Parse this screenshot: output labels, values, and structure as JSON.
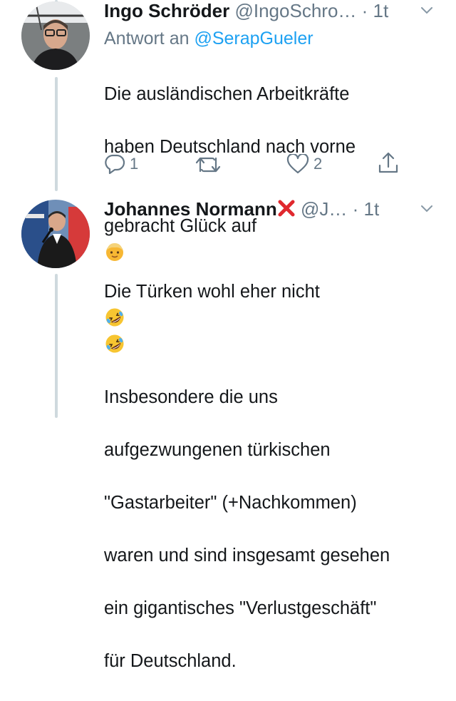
{
  "tweets": [
    {
      "author_name": "Ingo Schröder",
      "handle": "@IngoSchro…",
      "separator": "·",
      "time": "1t",
      "reply_to_prefix": "Antwort an",
      "reply_to_handle": "@SerapGueler",
      "text_lines": [
        "Die ausländischen Arbeitkräfte",
        "haben Deutschland nach vorne",
        "gebracht Glück auf"
      ],
      "actions": {
        "reply_count": "1",
        "retweet_count": "",
        "like_count": "2"
      }
    },
    {
      "author_name": "Johannes Normann",
      "handle": "@J…",
      "separator": "·",
      "time": "1t",
      "text_lines": [
        "Die Türken wohl eher nicht",
        "Insbesondere die uns",
        "aufgezwungenen türkischen",
        "\"Gastarbeiter\" (+Nachkommen)",
        "waren und sind insgesamt gesehen",
        "ein gigantisches \"Verlustgeschäft\"",
        "für Deutschland."
      ]
    }
  ],
  "icons": [
    "reply-icon",
    "retweet-icon",
    "like-icon",
    "share-icon",
    "chevron-down-icon",
    "cross-mark-emoji",
    "rolling-laughing-emoji",
    "child-face-emoji"
  ],
  "colors": {
    "text": "#14171a",
    "muted": "#657786",
    "link": "#1da1f2",
    "thread_line": "#cfd9de",
    "cross": "#e0282e"
  }
}
